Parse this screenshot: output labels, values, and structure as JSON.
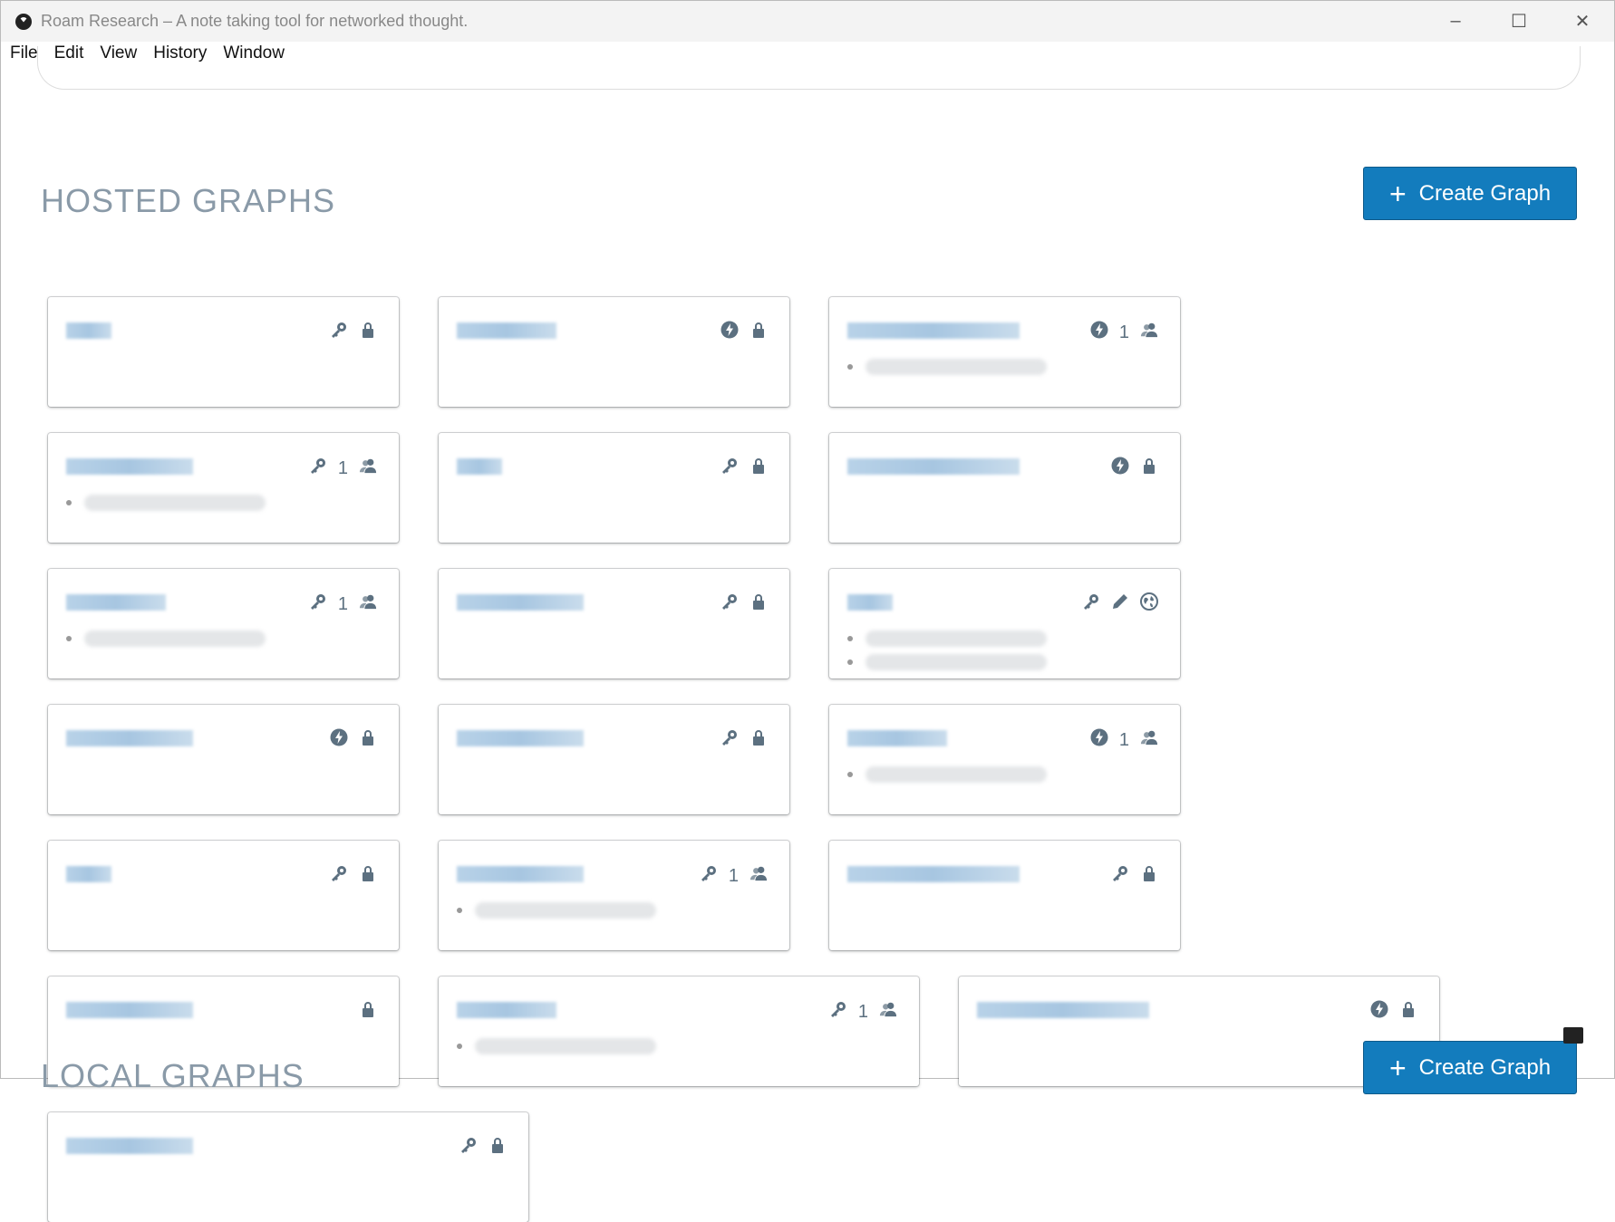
{
  "window": {
    "title": "Roam Research – A note taking tool for networked thought.",
    "controls": [
      "–",
      "☐",
      "✕"
    ]
  },
  "menu": [
    "File",
    "Edit",
    "View",
    "History",
    "Window"
  ],
  "hosted": {
    "heading": "HOSTED GRAPHS",
    "create_label": "Create Graph"
  },
  "local": {
    "heading": "LOCAL GRAPHS",
    "create_label": "Create Graph"
  },
  "cards": [
    {
      "icons": [
        "key",
        "lock"
      ],
      "bullets": 0
    },
    {
      "icons": [
        "bolt",
        "lock"
      ],
      "bullets": 0
    },
    {
      "icons": [
        "bolt"
      ],
      "members": "1",
      "bullets": 1
    },
    {
      "icons": [
        "key"
      ],
      "members": "1",
      "bullets": 1
    },
    {
      "icons": [
        "key",
        "lock"
      ],
      "bullets": 0
    },
    {
      "icons": [
        "bolt",
        "lock"
      ],
      "bullets": 0
    },
    {
      "icons": [
        "key"
      ],
      "members": "1",
      "bullets": 1
    },
    {
      "icons": [
        "key",
        "lock"
      ],
      "bullets": 0
    },
    {
      "icons": [
        "key",
        "pencil",
        "globe"
      ],
      "bullets": 2
    },
    {
      "icons": [
        "bolt",
        "lock"
      ],
      "bullets": 0
    },
    {
      "icons": [
        "key",
        "lock"
      ],
      "bullets": 0
    },
    {
      "icons": [
        "bolt"
      ],
      "members": "1",
      "bullets": 1
    },
    {
      "icons": [
        "key",
        "lock"
      ],
      "bullets": 0
    },
    {
      "icons": [
        "key"
      ],
      "members": "1",
      "bullets": 1
    },
    {
      "icons": [
        "key",
        "lock"
      ],
      "bullets": 0
    },
    {
      "icons": [
        "lock"
      ],
      "bullets": 0
    },
    {
      "icons": [
        "key"
      ],
      "members": "1",
      "bullets": 1,
      "wide": true
    },
    {
      "icons": [
        "bolt",
        "lock"
      ],
      "bullets": 0,
      "wide": true
    },
    {
      "icons": [
        "key",
        "lock"
      ],
      "bullets": 0,
      "wide": true
    }
  ]
}
